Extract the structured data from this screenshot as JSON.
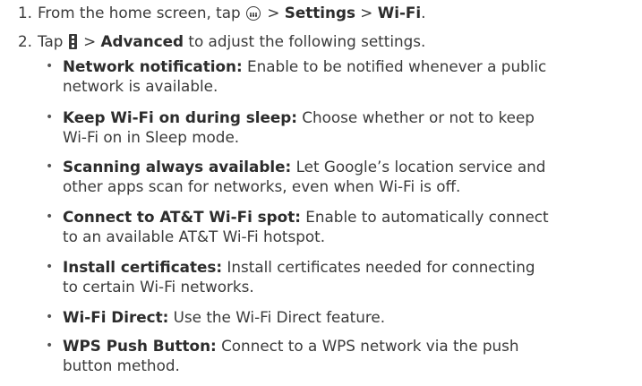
{
  "steps": [
    {
      "number": "1.",
      "before_icon": "From the home screen, tap ",
      "icon": "apps-icon",
      "after_icon": " > ",
      "bold1": "Settings",
      "sep": " > ",
      "bold2": "Wi-Fi",
      "end": "."
    },
    {
      "number": "2.",
      "before_icon": "Tap ",
      "icon": "menu-icon",
      "after_icon": " > ",
      "bold1": "Advanced",
      "rest": " to adjust the following settings."
    }
  ],
  "bullet_char": "•",
  "settings": [
    {
      "term": "Network notification:",
      "line1": " Enable to be notified whenever a public",
      "line2": "network is available."
    },
    {
      "term": "Keep Wi-Fi on during sleep:",
      "line1": " Choose whether or not to keep",
      "line2": "Wi-Fi on in Sleep mode."
    },
    {
      "term": "Scanning always available:",
      "line1": " Let Google’s location service and",
      "line2": "other apps scan for networks, even when Wi-Fi is off."
    },
    {
      "term": "Connect to AT&T Wi-Fi spot:",
      "line1": " Enable to automatically connect",
      "line2": "to an available AT&T Wi-Fi hotspot."
    },
    {
      "term": "Install certificates:",
      "line1": " Install certificates needed for connecting",
      "line2": "to certain Wi-Fi networks."
    },
    {
      "term": "Wi-Fi Direct:",
      "line1": " Use the Wi-Fi Direct feature.",
      "line2": ""
    },
    {
      "term": "WPS Push Button:",
      "line1": " Connect to a WPS network via the push",
      "line2": "button method."
    }
  ]
}
